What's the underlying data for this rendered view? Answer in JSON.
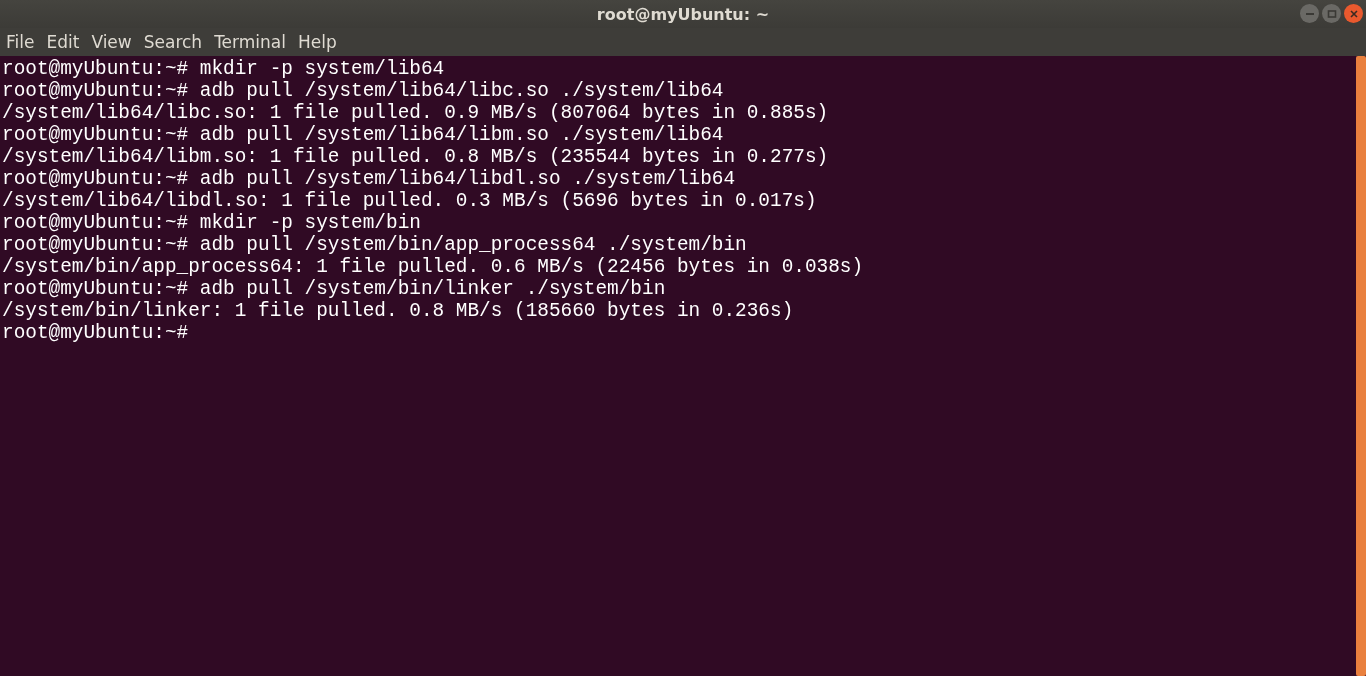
{
  "window": {
    "title": "root@myUbuntu: ~"
  },
  "menu": [
    "File",
    "Edit",
    "View",
    "Search",
    "Terminal",
    "Help"
  ],
  "terminal": {
    "lines": [
      "root@myUbuntu:~# mkdir -p system/lib64",
      "root@myUbuntu:~# adb pull /system/lib64/libc.so ./system/lib64",
      "/system/lib64/libc.so: 1 file pulled. 0.9 MB/s (807064 bytes in 0.885s)",
      "root@myUbuntu:~# adb pull /system/lib64/libm.so ./system/lib64",
      "/system/lib64/libm.so: 1 file pulled. 0.8 MB/s (235544 bytes in 0.277s)",
      "root@myUbuntu:~# adb pull /system/lib64/libdl.so ./system/lib64",
      "/system/lib64/libdl.so: 1 file pulled. 0.3 MB/s (5696 bytes in 0.017s)",
      "root@myUbuntu:~# mkdir -p system/bin",
      "root@myUbuntu:~# adb pull /system/bin/app_process64 ./system/bin",
      "/system/bin/app_process64: 1 file pulled. 0.6 MB/s (22456 bytes in 0.038s)",
      "root@myUbuntu:~# adb pull /system/bin/linker ./system/bin",
      "/system/bin/linker: 1 file pulled. 0.8 MB/s (185660 bytes in 0.236s)",
      "root@myUbuntu:~#"
    ]
  }
}
